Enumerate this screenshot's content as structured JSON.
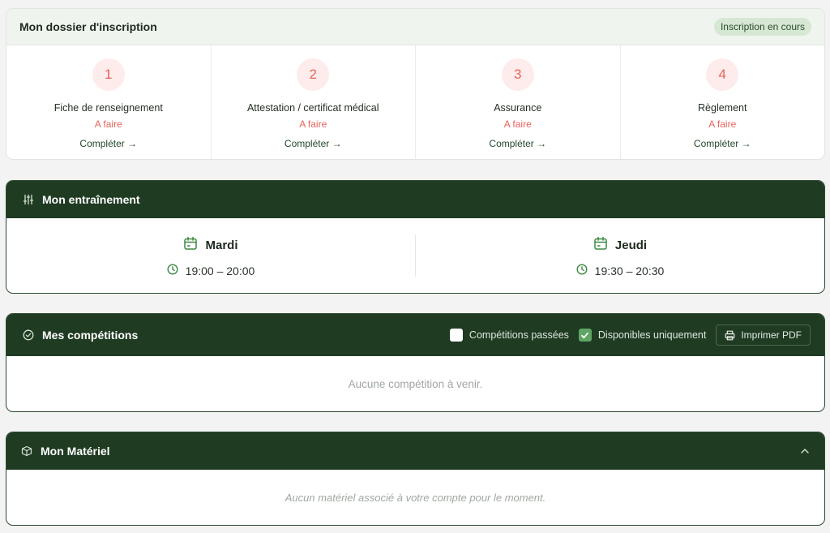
{
  "dossier": {
    "title": "Mon dossier d'inscription",
    "badge": "Inscription en cours",
    "steps": [
      {
        "number": "1",
        "label": "Fiche de renseignement",
        "status": "A faire",
        "action": "Compléter →"
      },
      {
        "number": "2",
        "label": "Attestation / certificat médical",
        "status": "A faire",
        "action": "Compléter →"
      },
      {
        "number": "3",
        "label": "Assurance",
        "status": "A faire",
        "action": "Compléter →"
      },
      {
        "number": "4",
        "label": "Règlement",
        "status": "A faire",
        "action": "Compléter →"
      }
    ]
  },
  "training": {
    "title": "Mon entraînement",
    "icon": "sliders-icon",
    "sessions": [
      {
        "day": "Mardi",
        "time": "19:00 – 20:00"
      },
      {
        "day": "Jeudi",
        "time": "19:30 – 20:30"
      }
    ]
  },
  "competitions": {
    "title": "Mes compétitions",
    "icon": "check-circle-icon",
    "filter_past": {
      "label": "Compétitions passées",
      "checked": false
    },
    "filter_available": {
      "label": "Disponibles uniquement",
      "checked": true
    },
    "print_label": "Imprimer PDF",
    "empty": "Aucune compétition à venir."
  },
  "materiel": {
    "title": "Mon Matériel",
    "icon": "box-icon",
    "empty": "Aucun matériel associé à votre compte pour le moment."
  },
  "colors": {
    "brand_dark": "#1f3b22",
    "todo_red": "#e8625b",
    "checkbox_green": "#5fa563"
  }
}
